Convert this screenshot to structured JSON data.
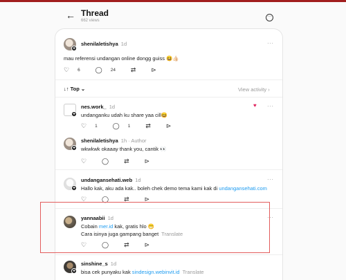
{
  "header": {
    "back_icon": "arrow-left-icon",
    "title": "Thread",
    "views": "662 views",
    "more_icon": "more-circle-icon"
  },
  "root_post": {
    "username": "shenilaletishya",
    "time": "1d",
    "text": "mau referensi undangan online dongg guiss 😆👍🏻",
    "likes": "6",
    "replies": "24"
  },
  "sort": {
    "label": "↓↑ Top",
    "chevron": "⌄",
    "view_activity": "View activity ›"
  },
  "replies": [
    {
      "username": "nes.work_",
      "time": "1d",
      "author": "",
      "text_parts": [
        "undanganku udah ku share yaa cill😆",
        "",
        ""
      ],
      "second_line": "",
      "likes": "1",
      "replies": "1"
    },
    {
      "username": "shenilaletishya",
      "time": "1h",
      "author": "· Author",
      "text_parts": [
        "wkwkwk okaaay thank you, cantik 👀",
        "",
        ""
      ],
      "second_line": "",
      "likes": "",
      "replies": ""
    },
    {
      "username": "undangansehati.web",
      "time": "1d",
      "author": "",
      "text_parts": [
        "Hallo kak, aku ada kak.. boleh chek demo tema kami kak di ",
        "undangansehati.com",
        ""
      ],
      "second_line": "",
      "likes": "",
      "replies": ""
    },
    {
      "username": "yannaabii",
      "time": "1d",
      "author": "",
      "text_parts": [
        "Cobain ",
        "mer.id",
        " kak, gratis hlo 😁"
      ],
      "second_line": "Cara isinya juga gampang banget",
      "translate": "Translate",
      "likes": "",
      "replies": ""
    },
    {
      "username": "sinshine_s",
      "time": "1d",
      "author": "",
      "text_parts": [
        "bisa cek punyaku kak ",
        "sindesign.webinvit.id",
        ""
      ],
      "translate": "Translate",
      "second_line": "",
      "likes": "",
      "replies": ""
    }
  ],
  "icons": {
    "like": "heart-icon",
    "reply": "comment-icon",
    "repost": "repost-icon",
    "share": "send-icon"
  },
  "colors": {
    "link": "#1d9bf0",
    "highlight": "#e25c5c",
    "top_bar": "#a11d1d"
  }
}
